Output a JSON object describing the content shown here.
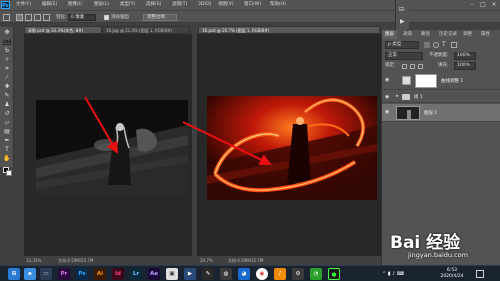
{
  "menubar": {
    "items": [
      "文件(F)",
      "编辑(E)",
      "图像(I)",
      "图层(L)",
      "类型(Y)",
      "选择(S)",
      "滤镜(T)",
      "3D(D)",
      "视图(V)",
      "窗口(W)",
      "帮助(H)"
    ]
  },
  "options_bar": {
    "feather_label": "羽化:",
    "feather_value": "0 像素",
    "antialias_label": "消除锯齿",
    "refine_button": "调整边缘..."
  },
  "documents": {
    "left": {
      "tab": "采影.psd @ 33.3%(灰色, 8#)",
      "tab2": "16.jpg @ 21.4% (图层 1, RGB/8#)",
      "zoom": "33.33%",
      "status": "文档:6.59M/25.7M"
    },
    "right": {
      "tab": "16.psd @ 20.7% (图层 1, RGB/8#)",
      "zoom": "20.7%",
      "status": "文档:6.59M/32.7M"
    }
  },
  "panels": {
    "tabs": [
      "图层",
      "通道",
      "路径",
      "历史记录",
      "调整",
      "属性"
    ],
    "filter_label": "ρ 类型",
    "blend_mode": "正常",
    "opacity_label": "不透明度:",
    "opacity_value": "100%",
    "lock_label": "锁定:",
    "fill_label": "填充:",
    "fill_value": "100%",
    "layers": [
      {
        "name": "曲线调整 1"
      },
      {
        "name": "组 1"
      },
      {
        "name": "图层 1"
      }
    ]
  },
  "taskbar": {
    "apps": [
      "Pr",
      "Ps",
      "Ai",
      "Id",
      "Lr",
      "Ae"
    ],
    "time": "6:53",
    "date": "2020/4/24"
  },
  "watermark": {
    "brand": "Bai 经验",
    "url": "jingyan.baidu.com"
  },
  "colors": {
    "accent_ps": "#31a8ff",
    "arrow": "#e81010",
    "fire": "#ff4a10"
  }
}
